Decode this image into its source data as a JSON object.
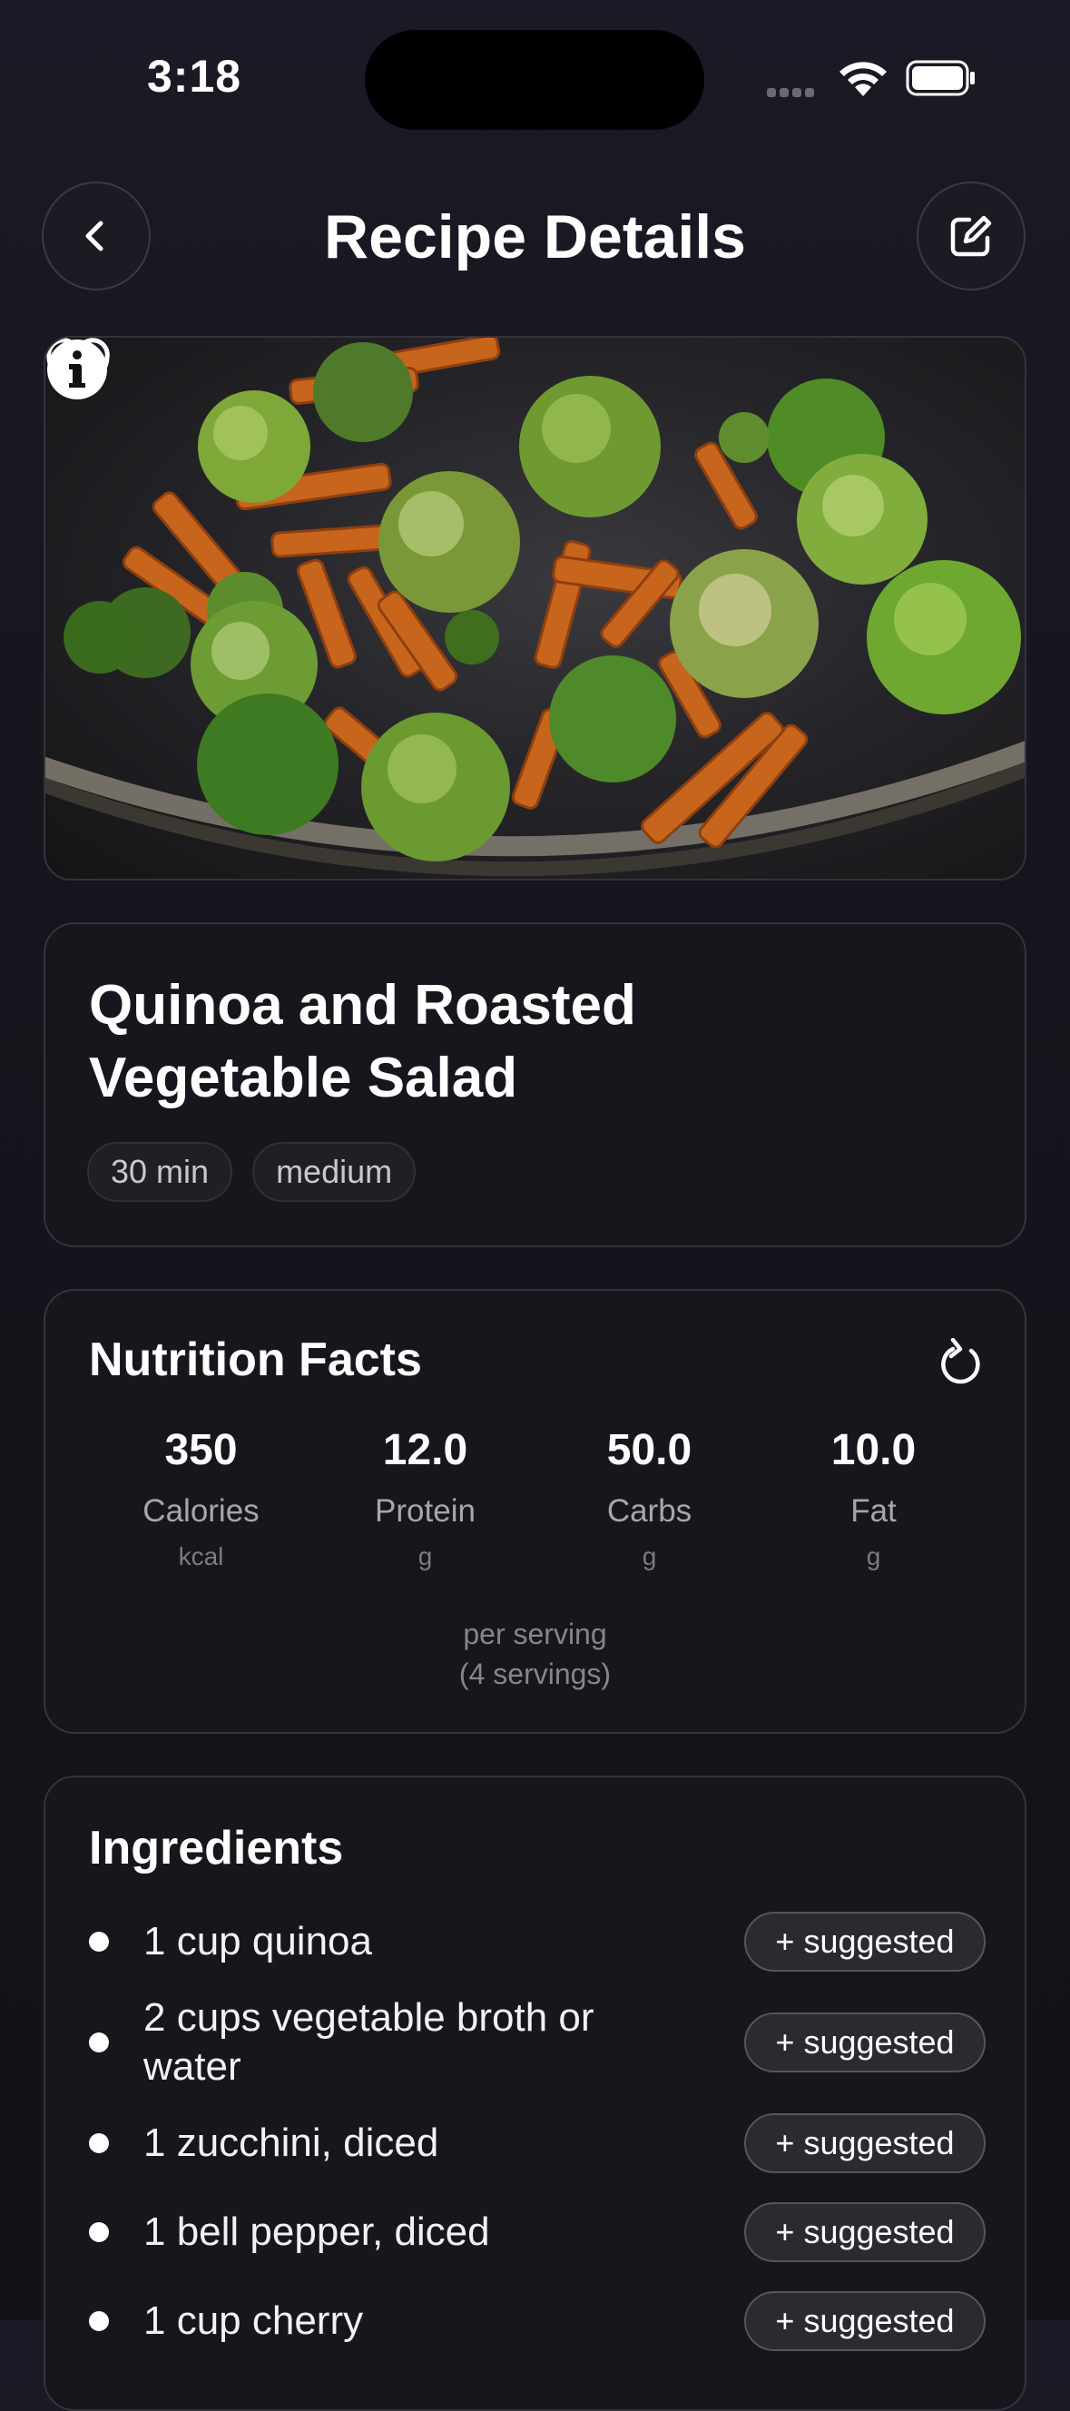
{
  "status_bar": {
    "time": "3:18"
  },
  "header": {
    "title": "Recipe Details"
  },
  "recipe": {
    "title": "Quinoa and Roasted Vegetable Salad",
    "tags": [
      "30 min",
      "medium"
    ]
  },
  "nutrition": {
    "heading": "Nutrition Facts",
    "items": [
      {
        "value": "350",
        "label": "Calories",
        "unit": "kcal"
      },
      {
        "value": "12.0",
        "label": "Protein",
        "unit": "g"
      },
      {
        "value": "50.0",
        "label": "Carbs",
        "unit": "g"
      },
      {
        "value": "10.0",
        "label": "Fat",
        "unit": "g"
      }
    ],
    "serving_line1": "per serving",
    "serving_line2": "(4 servings)"
  },
  "ingredients": {
    "heading": "Ingredients",
    "items": [
      {
        "text": "1 cup quinoa",
        "action": "+ suggested"
      },
      {
        "text": "2 cups vegetable broth or water",
        "action": "+ suggested"
      },
      {
        "text": "1 zucchini, diced",
        "action": "+ suggested"
      },
      {
        "text": "1 bell pepper, diced",
        "action": "+ suggested"
      },
      {
        "text": "1 cup cherry",
        "action": "+ suggested"
      }
    ]
  },
  "icons": {
    "back": "chevron-left-icon",
    "edit": "edit-icon",
    "favorite": "heart-icon",
    "info": "info-icon",
    "refresh": "refresh-icon"
  }
}
